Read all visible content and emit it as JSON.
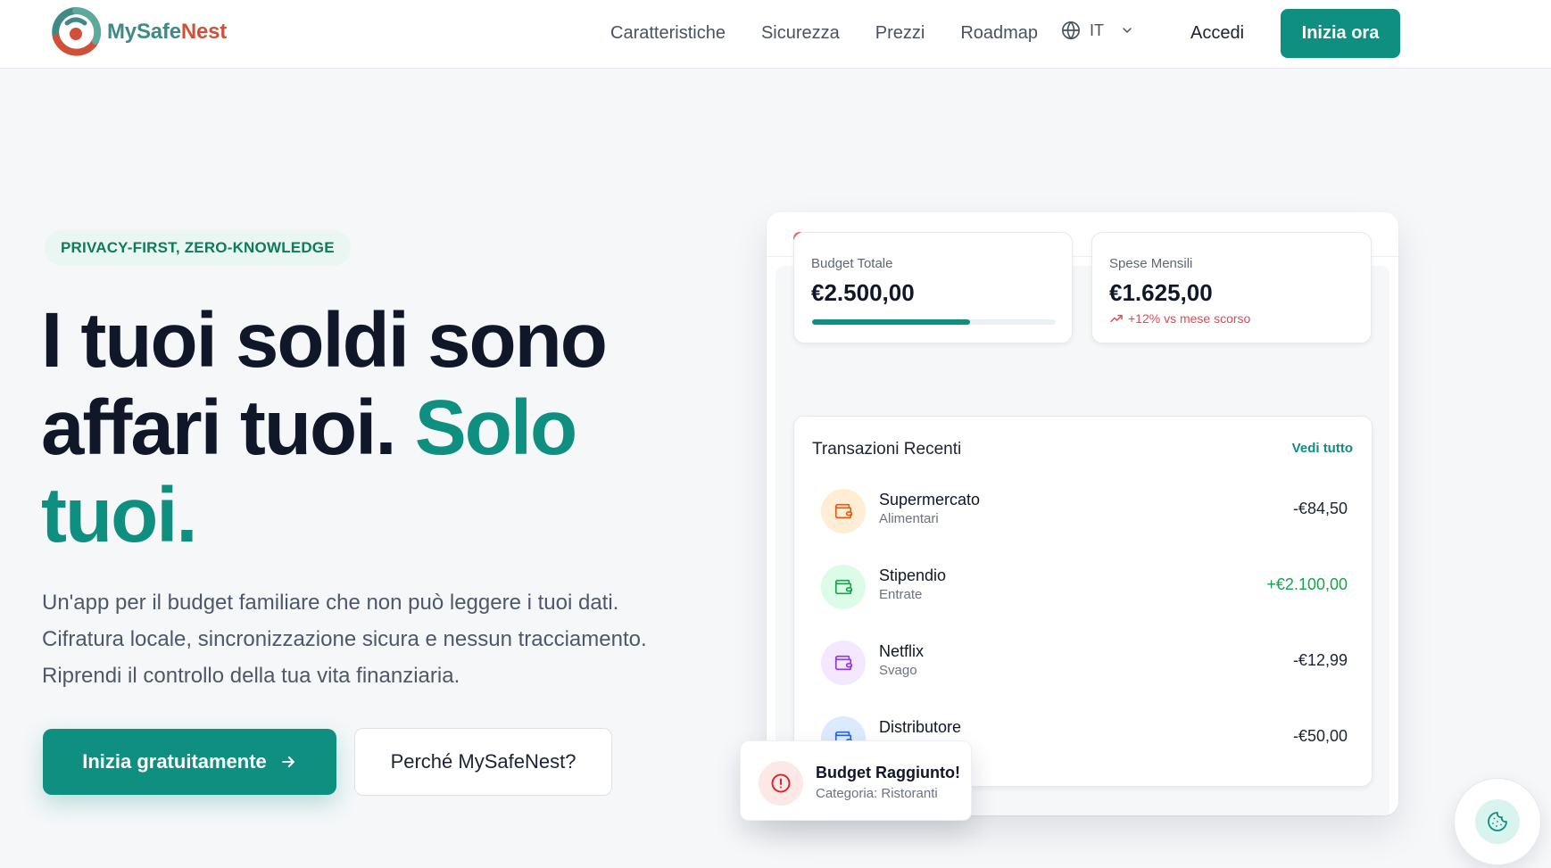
{
  "nav": {
    "brand_part1": "MySafe",
    "brand_part2": "Nest",
    "links": [
      "Caratteristiche",
      "Sicurezza",
      "Prezzi",
      "Roadmap"
    ],
    "language": "IT",
    "signin_label": "Accedi",
    "cta_label": "Inizia ora"
  },
  "hero": {
    "badge": "PRIVACY-FIRST, ZERO-KNOWLEDGE",
    "title_line1": "I tuoi soldi sono",
    "title_line2a": "affari tuoi. ",
    "title_accent_a": "Solo",
    "title_accent_b": "tuoi.",
    "subtitle_line1": "Un'app per il budget familiare che non può leggere i tuoi dati.",
    "subtitle_line2": "Cifratura locale, sincronizzazione sicura e nessun tracciamento.",
    "subtitle_line3": "Riprendi il controllo della tua vita finanziaria.",
    "primary_button": "Inizia gratuitamente",
    "secondary_button": "Perché MySafeNest?"
  },
  "dashboard": {
    "budget": {
      "label": "Budget Totale",
      "value": "€2.500,00",
      "progress": 0.65
    },
    "spending": {
      "label": "Spese Mensili",
      "value": "€1.625,00",
      "trend": "+12% vs mese scorso"
    },
    "transactions_title": "Transazioni Recenti",
    "see_all": "Vedi tutto",
    "transactions": [
      {
        "name": "Supermercato",
        "category": "Alimentari",
        "amount": "-€84,50",
        "color": "#ea580c",
        "bg": "#ffedd5",
        "icon": "wallet-icon"
      },
      {
        "name": "Stipendio",
        "category": "Entrate",
        "amount": "+€2.100,00",
        "color": "#16a34a",
        "bg": "#dcfce7",
        "icon": "wallet-icon"
      },
      {
        "name": "Netflix",
        "category": "Svago",
        "amount": "-€12,99",
        "color": "#9333ea",
        "bg": "#f3e8ff",
        "icon": "wallet-icon"
      },
      {
        "name": "Distributore",
        "category": "",
        "amount": "-€50,00",
        "color": "#2563eb",
        "bg": "#dbeafe",
        "icon": "wallet-icon"
      }
    ]
  },
  "toast": {
    "title": "Budget Raggiunto!",
    "subtitle": "Categoria: Ristoranti",
    "icon": "alert-circle-icon"
  },
  "colors": {
    "brand": "#0e8f80",
    "negative": "#e5484d",
    "positive": "#16a34a"
  },
  "cookie": {
    "icon": "cookie-icon"
  }
}
